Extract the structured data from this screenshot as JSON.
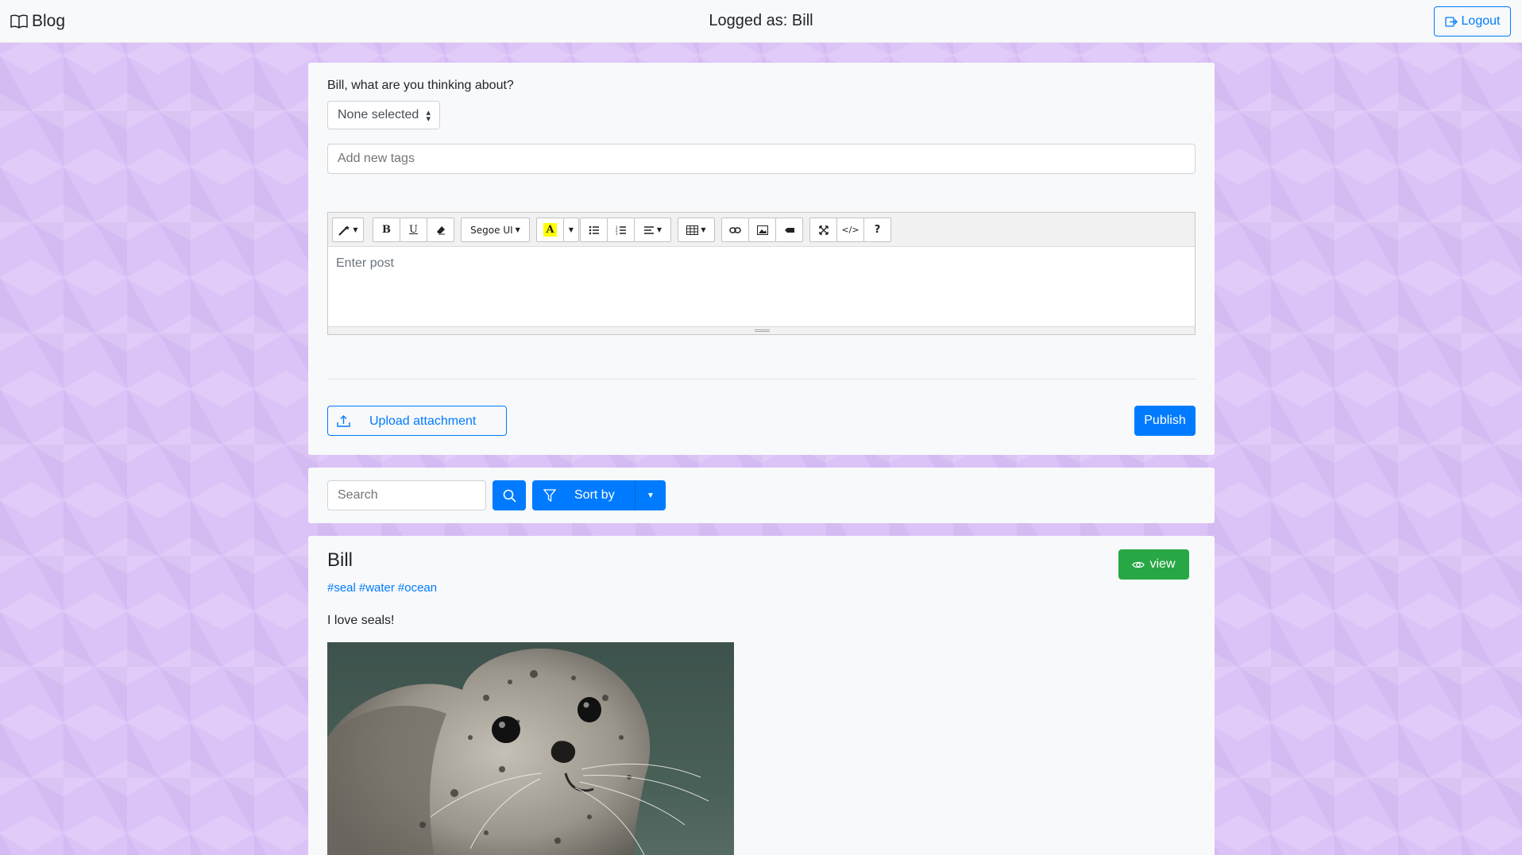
{
  "navbar": {
    "brand_label": "Blog",
    "title": "Logged as: Bill",
    "logout_label": "Logout"
  },
  "composer": {
    "prompt": "Bill, what are you thinking about?",
    "category_select": "None selected",
    "tags_placeholder": "Add new tags",
    "editor_placeholder": "Enter post",
    "font_name": "Segoe UI",
    "upload_label": "Upload attachment",
    "publish_label": "Publish"
  },
  "toolbar_icons": [
    "magic-icon",
    "bold-icon",
    "underline-icon",
    "eraser-icon",
    "font-name-dropdown",
    "font-color-icon",
    "bullet-list-icon",
    "numbered-list-icon",
    "align-icon",
    "table-icon",
    "link-icon",
    "picture-icon",
    "video-icon",
    "fullscreen-icon",
    "code-view-icon",
    "help-icon"
  ],
  "search": {
    "placeholder": "Search",
    "sort_label": "Sort by"
  },
  "post": {
    "author": "Bill",
    "tags": [
      "#seal",
      "#water",
      "#ocean"
    ],
    "text": "I love seals!",
    "view_label": "view"
  },
  "colors": {
    "primary": "#007bff",
    "success": "#28a745",
    "background": "#dcc3f7",
    "card": "#f8f9fa"
  }
}
